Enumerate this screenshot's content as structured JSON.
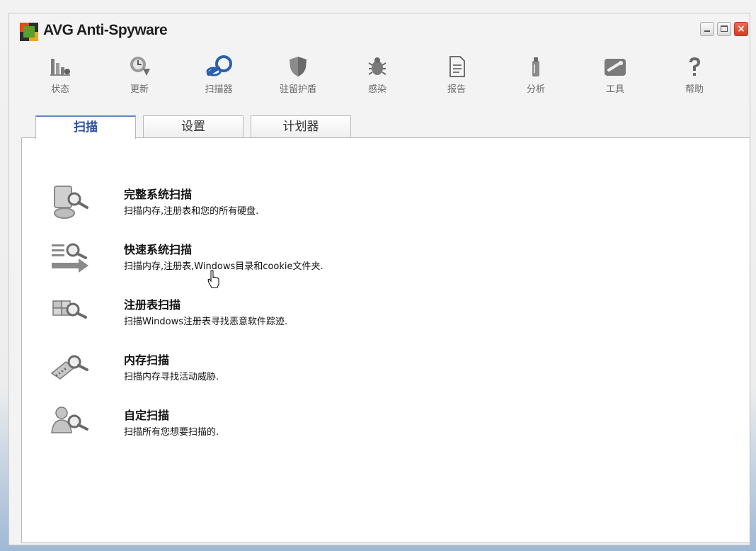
{
  "app": {
    "title": "AVG Anti-Spyware"
  },
  "window_controls": {
    "close_glyph": "×"
  },
  "toolbar": {
    "items": [
      {
        "label": "状态",
        "icon": "status-icon"
      },
      {
        "label": "更新",
        "icon": "update-icon"
      },
      {
        "label": "扫描器",
        "icon": "scanner-icon"
      },
      {
        "label": "驻留护盾",
        "icon": "shield-icon"
      },
      {
        "label": "感染",
        "icon": "infection-icon"
      },
      {
        "label": "报告",
        "icon": "report-icon"
      },
      {
        "label": "分析",
        "icon": "analysis-icon"
      },
      {
        "label": "工具",
        "icon": "tools-icon"
      },
      {
        "label": "帮助",
        "icon": "help-icon"
      }
    ]
  },
  "tabs": [
    {
      "label": "扫描",
      "active": true
    },
    {
      "label": "设置",
      "active": false
    },
    {
      "label": "计划器",
      "active": false
    }
  ],
  "scans": [
    {
      "title": "完整系统扫描",
      "desc": "扫描内存,注册表和您的所有硬盘."
    },
    {
      "title": "快速系统扫描",
      "desc": "扫描内存,注册表,Windows目录和cookie文件夹."
    },
    {
      "title": "注册表扫描",
      "desc": "扫描Windows注册表寻找恶意软件踪迹."
    },
    {
      "title": "内存扫描",
      "desc": "扫描内存寻找活动威胁."
    },
    {
      "title": "自定扫描",
      "desc": "扫描所有您想要扫描的."
    }
  ],
  "colors": {
    "active_tab_text": "#2a4fa0",
    "scanner_icon": "#2a5fb0"
  }
}
